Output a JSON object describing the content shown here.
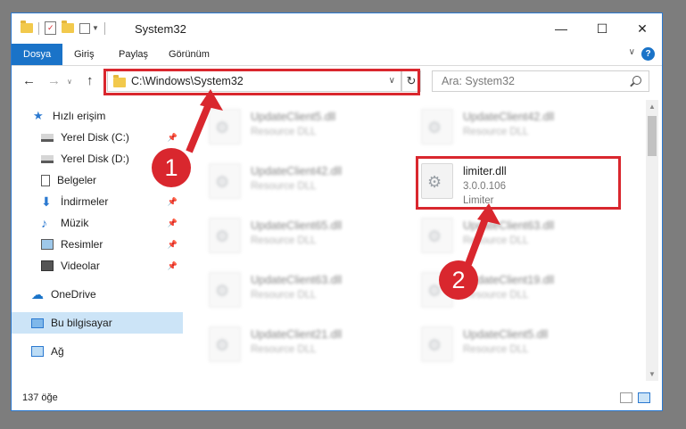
{
  "window": {
    "title": "System32",
    "controls": {
      "minimize": "—",
      "maximize": "☐",
      "close": "✕"
    }
  },
  "ribbon": {
    "tabs": [
      "Dosya",
      "Giriş",
      "Paylaş",
      "Görünüm"
    ],
    "help": "?"
  },
  "navigation": {
    "address": "C:\\Windows\\System32",
    "search_placeholder": "Ara: System32"
  },
  "sidebar": {
    "items": [
      {
        "label": "Hızlı erişim",
        "icon": "star-icon",
        "pinned": false
      },
      {
        "label": "Yerel Disk (C:)",
        "icon": "drive-icon",
        "pinned": true
      },
      {
        "label": "Yerel Disk (D:)",
        "icon": "drive-icon",
        "pinned": true
      },
      {
        "label": "Belgeler",
        "icon": "document-icon",
        "pinned": true
      },
      {
        "label": "İndirmeler",
        "icon": "download-icon",
        "pinned": true
      },
      {
        "label": "Müzik",
        "icon": "music-icon",
        "pinned": true
      },
      {
        "label": "Resimler",
        "icon": "image-icon",
        "pinned": true
      },
      {
        "label": "Videolar",
        "icon": "video-icon",
        "pinned": true
      },
      {
        "label": "OneDrive",
        "icon": "cloud-icon",
        "pinned": false
      },
      {
        "label": "Bu bilgisayar",
        "icon": "computer-icon",
        "pinned": false
      },
      {
        "label": "Ağ",
        "icon": "network-icon",
        "pinned": false
      }
    ]
  },
  "files": [
    {
      "name": "UpdateClient5.dll",
      "type": "Resource DLL"
    },
    {
      "name": "UpdateClient42.dll",
      "type": "Resource DLL"
    },
    {
      "name": "UpdateClient42.dll",
      "type": "Resource DLL"
    },
    {
      "name": "limiter.dll",
      "version": "3.0.0.106",
      "type": "Limiter"
    },
    {
      "name": "UpdateClient65.dll",
      "type": "Resource DLL"
    },
    {
      "name": "UpdateClient63.dll",
      "type": "Resource DLL"
    },
    {
      "name": "UpdateClient63.dll",
      "type": "Resource DLL"
    },
    {
      "name": "UpdateClient19.dll",
      "type": "Resource DLL"
    },
    {
      "name": "UpdateClient21.dll",
      "type": "Resource DLL"
    },
    {
      "name": "UpdateClient5.dll",
      "type": "Resource DLL"
    }
  ],
  "status": {
    "item_count": "137 öğe"
  },
  "annotations": {
    "step1": "1",
    "step2": "2",
    "highlight_color": "#d9272e"
  }
}
